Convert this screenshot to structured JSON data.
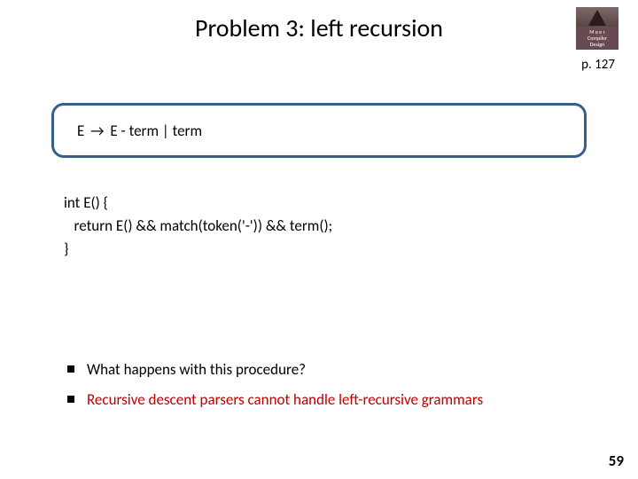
{
  "title": "Problem 3: left recursion",
  "page_ref": "p. 127",
  "badge": {
    "line1": "M o e r",
    "line2": "Compiler",
    "line3": "Design"
  },
  "grammar": {
    "lhs": "E",
    "arrow": "→",
    "rhs": "E - term | term"
  },
  "code": {
    "line1": "int E() {",
    "line2": "   return E() && match(token('-')) && term();",
    "line3": "}"
  },
  "bullets": [
    {
      "text": "What happens with this procedure?",
      "red": false
    },
    {
      "text": "Recursive descent parsers cannot handle left-recursive grammars",
      "red": true
    }
  ],
  "slide_number": "59"
}
